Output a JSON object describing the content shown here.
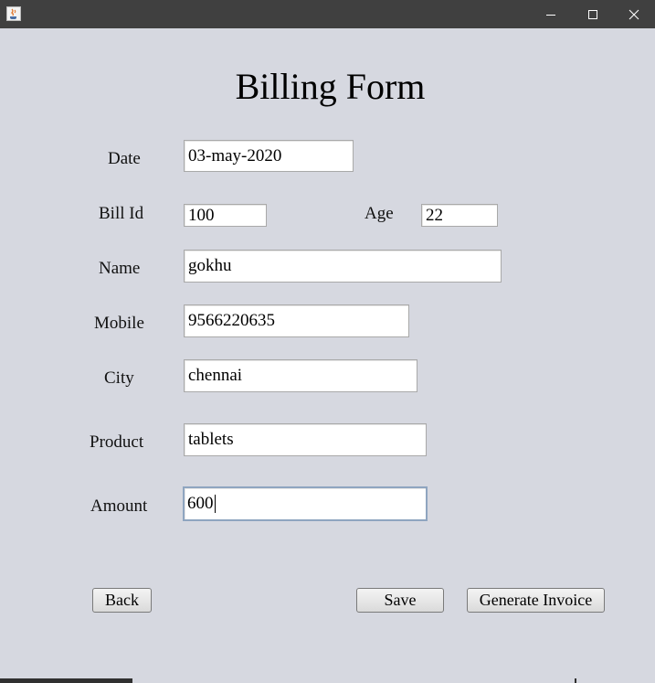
{
  "window": {
    "app_icon": "java-icon",
    "controls": [
      "minimize-icon",
      "maximize-icon",
      "close-icon"
    ]
  },
  "form": {
    "title": "Billing Form",
    "fields": {
      "date": {
        "label": "Date",
        "value": "03-may-2020"
      },
      "bill_id": {
        "label": "Bill Id",
        "value": "100"
      },
      "age": {
        "label": "Age",
        "value": "22"
      },
      "name": {
        "label": "Name",
        "value": "gokhu"
      },
      "mobile": {
        "label": "Mobile",
        "value": "9566220635"
      },
      "city": {
        "label": "City",
        "value": "chennai"
      },
      "product": {
        "label": "Product",
        "value": "tablets"
      },
      "amount": {
        "label": "Amount",
        "value": "600"
      }
    }
  },
  "buttons": {
    "back": "Back",
    "save": "Save",
    "generate_invoice": "Generate Invoice"
  },
  "colors": {
    "background": "#d6d8e0",
    "titlebar": "#404040",
    "focus_border": "#8fa5c0"
  }
}
